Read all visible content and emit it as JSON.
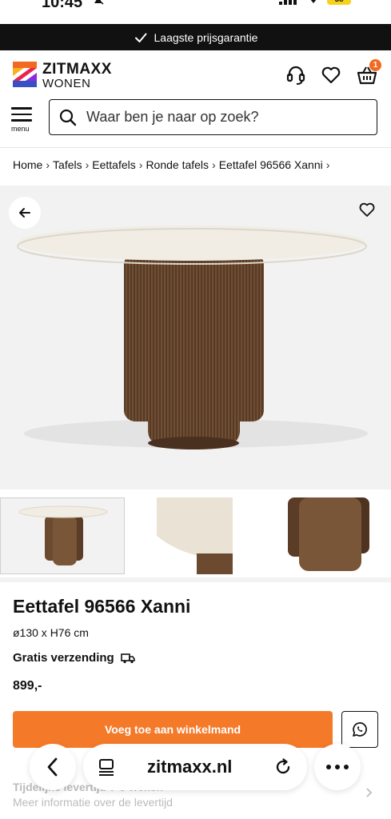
{
  "status_bar": {
    "time": "10:45",
    "battery": "58"
  },
  "promo": {
    "text": "Laagste prijsgarantie"
  },
  "header": {
    "brand_line1": "ZITMAXX",
    "brand_line2": "WONEN",
    "cart_count": "1",
    "icons": [
      "customer-support-icon",
      "heart-icon",
      "basket-icon"
    ]
  },
  "menu": {
    "label": "menu"
  },
  "search": {
    "placeholder": "Waar ben je naar op zoek?"
  },
  "breadcrumb": {
    "items": [
      "Home",
      "Tafels",
      "Eettafels",
      "Ronde tafels",
      "Eettafel 96566 Xanni"
    ],
    "separator": "›"
  },
  "product": {
    "title": "Eettafel 96566 Xanni",
    "dimensions": "ø130 x H76 cm",
    "shipping": "Gratis verzending",
    "price": "899,-",
    "add_to_cart": "Voeg toe aan winkelmand"
  },
  "delivery": {
    "title": "Tijdelijke levertijd 7-9 weken",
    "info": "Meer informatie over de levertijd"
  },
  "browser": {
    "url": "zitmaxx.nl"
  },
  "colors": {
    "accent": "#f47a2a",
    "promo_bg": "#111111",
    "wood": "#6b4a30",
    "marble": "#f1ede4"
  }
}
